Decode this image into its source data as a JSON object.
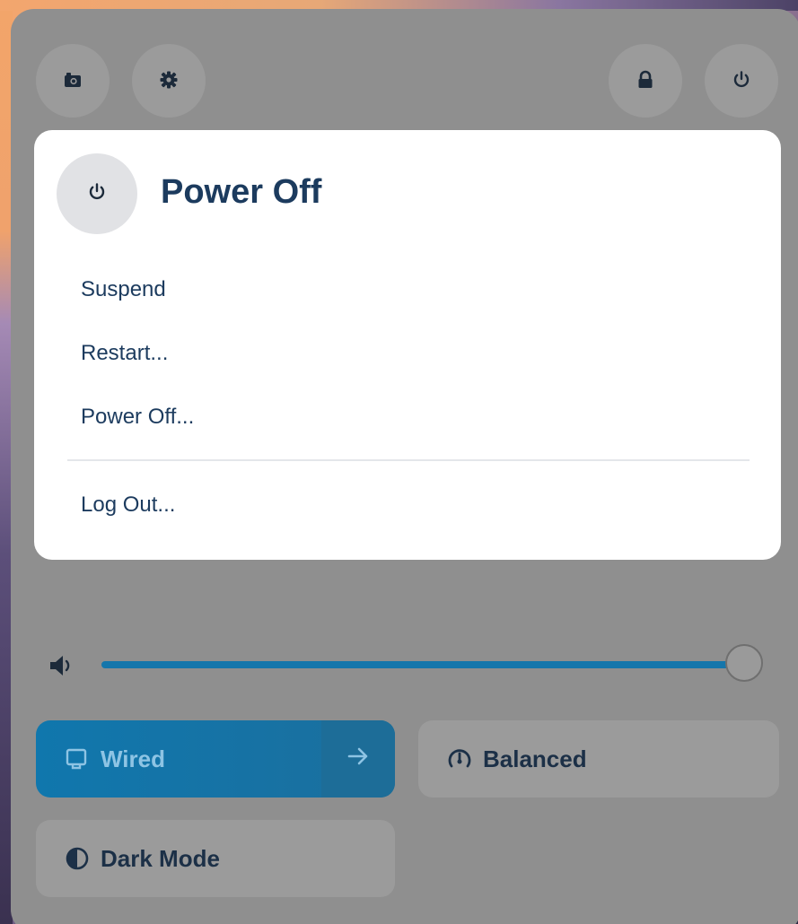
{
  "top_bar": {
    "screenshot_button": {
      "icon": "camera-icon"
    },
    "settings_button": {
      "icon": "gear-icon"
    },
    "lock_button": {
      "icon": "lock-icon"
    },
    "power_button": {
      "icon": "power-icon"
    }
  },
  "power_menu": {
    "title": "Power Off",
    "header_icon": "power-icon",
    "items": [
      {
        "label": "Suspend"
      },
      {
        "label": "Restart..."
      },
      {
        "label": "Power Off..."
      },
      {
        "label": "Log Out..."
      }
    ]
  },
  "volume": {
    "icon": "speaker-icon",
    "level": 1.0
  },
  "tiles": {
    "wired": {
      "label": "Wired",
      "icon": "network-wired-icon",
      "arrow_icon": "arrow-right-icon",
      "active": true
    },
    "balanced": {
      "label": "Balanced",
      "icon": "power-profile-icon",
      "active": false
    },
    "dark_mode": {
      "label": "Dark Mode",
      "icon": "dark-mode-icon",
      "active": false
    }
  },
  "colors": {
    "panel_bg": "#8f8f8f",
    "popup_bg": "#ffffff",
    "text_dark": "#1c3b5e",
    "accent": "#1576ab"
  }
}
